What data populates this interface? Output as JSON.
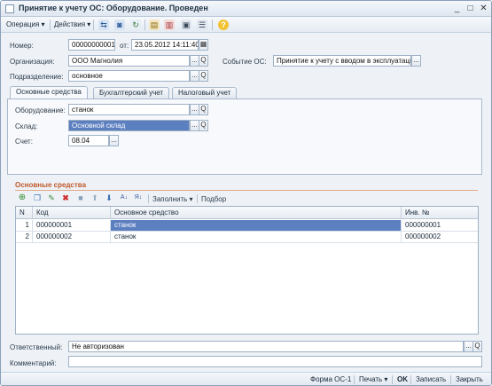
{
  "window": {
    "title": "Принятие к учету ОС: Оборудование. Проведен",
    "minimize": "_",
    "maximize": "□",
    "close": "✕"
  },
  "toolbar": {
    "operation": "Операция ▾",
    "actions": "Действия ▾"
  },
  "header": {
    "number_label": "Номер:",
    "number_value": "00000000001",
    "date_label": "от:",
    "date_value": "23.05.2012 14:11:40",
    "org_label": "Организация:",
    "org_value": "ООО Магнолия",
    "event_label": "Событие ОС:",
    "event_value": "Принятие к учету с вводом в эксплуатаци",
    "dept_label": "Подразделение:",
    "dept_value": "основное"
  },
  "tabs": [
    {
      "label": "Основные средства"
    },
    {
      "label": "Бухгалтерский учет"
    },
    {
      "label": "Налоговый учет"
    }
  ],
  "tab_panel": {
    "equipment_label": "Оборудование:",
    "equipment_value": "станок",
    "warehouse_label": "Склад:",
    "warehouse_value": "Основной склад",
    "account_label": "Счет:",
    "account_value": "08.04"
  },
  "assets_section": {
    "title": "Основные средства",
    "fill_label": "Заполнить ▾",
    "select_label": "Подбор",
    "columns": [
      "N",
      "Код",
      "Основное средство",
      "Инв. №"
    ],
    "rows": [
      {
        "n": "1",
        "code": "000000001",
        "asset": "станок",
        "inv": "000000001"
      },
      {
        "n": "2",
        "code": "000000002",
        "asset": "станок",
        "inv": "000000002"
      }
    ]
  },
  "footer": {
    "responsible_label": "Ответственный:",
    "responsible_value": "Не авторизован",
    "comment_label": "Комментарий:",
    "comment_value": ""
  },
  "statusbar": {
    "form": "Форма ОС-1",
    "print": "Печать ▾",
    "ok": "OK",
    "save": "Записать",
    "close": "Закрыть"
  },
  "colors": {
    "accent": "#5c7fc0",
    "section_title": "#c0582a"
  },
  "icons": {
    "ellipsis": "...",
    "search": "Q",
    "calendar": "▦"
  }
}
